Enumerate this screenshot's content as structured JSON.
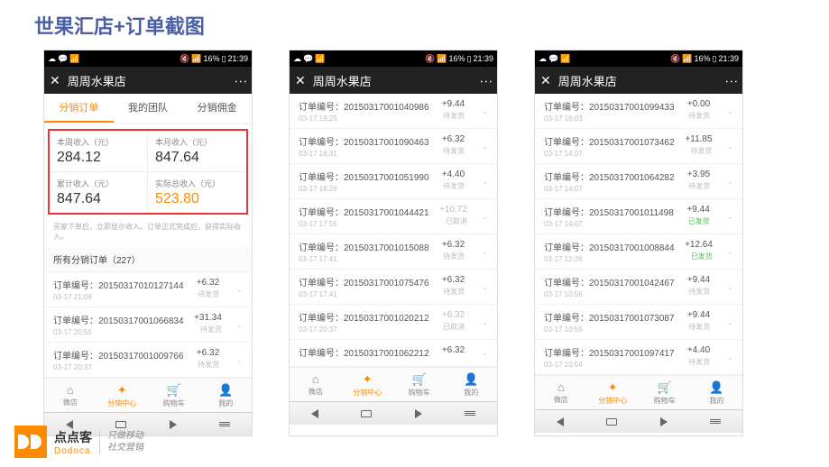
{
  "slide_title": "世果汇店+订单截图",
  "statusbar": {
    "battery": "16%",
    "time": "21:39"
  },
  "appbar": {
    "title": "周周水果店"
  },
  "tabs": {
    "t1": "分销订单",
    "t2": "我的团队",
    "t3": "分销佣金"
  },
  "stats": {
    "s1_label": "本周收入（元）",
    "s1_value": "284.12",
    "s2_label": "本月收入（元）",
    "s2_value": "847.64",
    "s3_label": "累计收入（元）",
    "s3_value": "847.64",
    "s4_label": "实际总收入（元）",
    "s4_value": "523.80"
  },
  "hint": "买家下单后，立即显示收入。订单正式完成后，获得实际收入。",
  "section_header": "所有分销订单（227）",
  "order_prefix": "订单编号：",
  "nav": {
    "n1": "微店",
    "n2": "分销中心",
    "n3": "购物车",
    "n4": "我的"
  },
  "phone1_orders": [
    {
      "id": "20150317010127144",
      "time": "03-17 21:08",
      "amount": "+6.32",
      "status": "待发货"
    },
    {
      "id": "20150317001066834",
      "time": "03-17 20:55",
      "amount": "+31.34",
      "status": "待发货"
    },
    {
      "id": "20150317001009766",
      "time": "03-17 20:37",
      "amount": "+6.32",
      "status": "待发货"
    }
  ],
  "phone2_orders": [
    {
      "id": "20150317001040986",
      "time": "03-17 19:25",
      "amount": "+9.44",
      "status": "待发货"
    },
    {
      "id": "20150317001090463",
      "time": "03-17 18:31",
      "amount": "+6.32",
      "status": "待发货"
    },
    {
      "id": "20150317001051990",
      "time": "03-17 18:26",
      "amount": "+4.40",
      "status": "待发货"
    },
    {
      "id": "20150317001044421",
      "time": "03-17 17:55",
      "amount": "+10.72",
      "status": "已取消",
      "cancel": true
    },
    {
      "id": "20150317001015088",
      "time": "03-17 17:41",
      "amount": "+6.32",
      "status": "待发货"
    },
    {
      "id": "20150317001075476",
      "time": "03-17 17:41",
      "amount": "+6.32",
      "status": "待发货"
    },
    {
      "id": "20150317001020212",
      "time": "03-17 20:37",
      "amount": "+6.32",
      "status": "已取消",
      "cancel": true
    },
    {
      "id": "20150317001062212",
      "time": "",
      "amount": "+6.32",
      "status": ""
    }
  ],
  "phone3_orders": [
    {
      "id": "20150317001099433",
      "time": "03-17 16:03",
      "amount": "+0.00",
      "status": "待发货"
    },
    {
      "id": "20150317001073462",
      "time": "03-17 14:07",
      "amount": "+11.85",
      "status": "待发货"
    },
    {
      "id": "20150317001064282",
      "time": "03-17 14:07",
      "amount": "+3.95",
      "status": "待发货"
    },
    {
      "id": "20150317001011498",
      "time": "03-17 14:07",
      "amount": "+9.44",
      "status": "已发货",
      "green": true
    },
    {
      "id": "20150317001008844",
      "time": "03-17 12:26",
      "amount": "+12.64",
      "status": "已发货",
      "green": true
    },
    {
      "id": "20150317001042467",
      "time": "03-17 10:56",
      "amount": "+9.44",
      "status": "待发货"
    },
    {
      "id": "20150317001073087",
      "time": "03-17 10:55",
      "amount": "+9.44",
      "status": "待发货"
    },
    {
      "id": "20150317001097417",
      "time": "03-17 10:54",
      "amount": "+4.40",
      "status": "待发货"
    }
  ],
  "footer": {
    "brand_cn": "点点客",
    "brand_en": "Dodoca",
    "slogan1": "只做移动",
    "slogan2": "社交营销"
  }
}
